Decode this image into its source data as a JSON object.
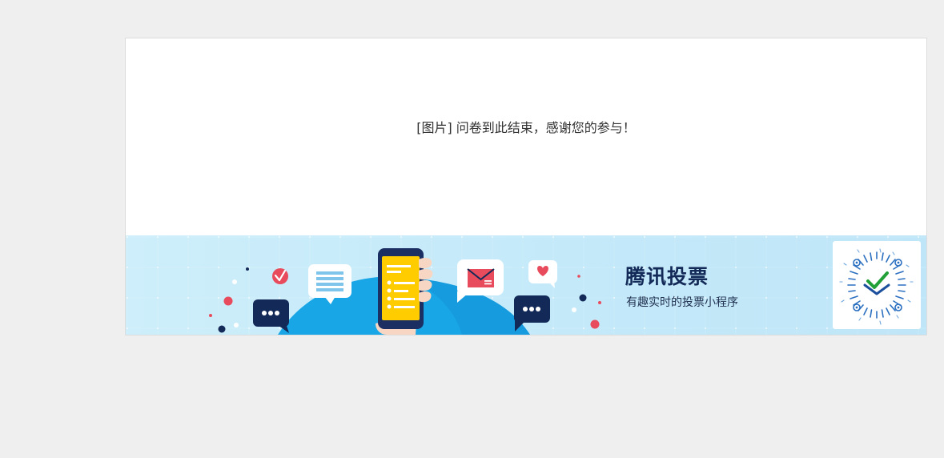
{
  "survey": {
    "end_message": "[图片] 问卷到此结束，感谢您的参与！"
  },
  "banner": {
    "title": "腾讯投票",
    "subtitle": "有趣实时的投票小程序",
    "icons": [
      "phone-checklist-illustration",
      "chat-bubble-icon",
      "mail-icon",
      "heart-icon",
      "check-icon",
      "list-icon",
      "qr-code-icon"
    ]
  },
  "colors": {
    "page_background": "#efefef",
    "card_background": "#ffffff",
    "banner_background": "#c7eaf8",
    "brand_navy": "#132a58",
    "accent_red": "#e84b5c",
    "accent_blue": "#18a6e6",
    "phone_yellow": "#ffcc00"
  }
}
